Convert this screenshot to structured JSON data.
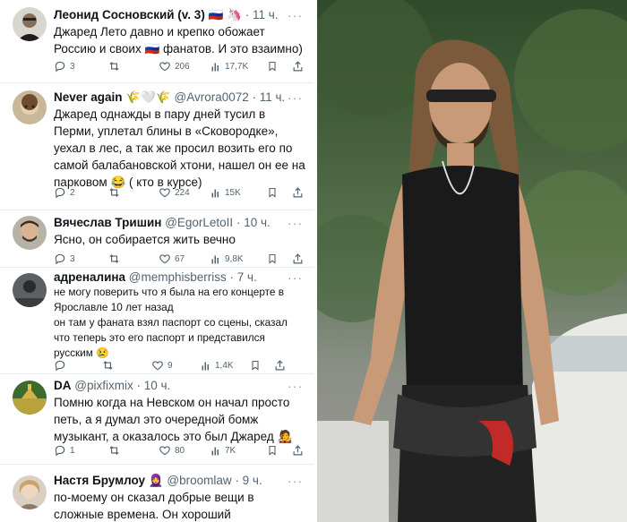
{
  "tweets": [
    {
      "author": "Леонид Сосновский (v. 3) 🇷🇺 🦄",
      "handle": "",
      "time": "· 11 ч.",
      "text": "Джаред Лето давно и крепко обожает Россию и своих 🇷🇺 фанатов. И это взаимно)",
      "replies": "3",
      "retweets": "",
      "likes": "206",
      "views": "17,7K"
    },
    {
      "author": "Never again 🌾🤍🌾",
      "handle": "@Avrora0072",
      "time": "· 11 ч.",
      "text": "Джаред однажды в пару дней тусил в Перми, уплетал блины в «Сковородке», уехал в лес, а так же просил возить его по самой балабановской хтони, нашел он ее на парковом 😂 ( кто в курсе)",
      "replies": "2",
      "retweets": "",
      "likes": "224",
      "views": "15K"
    },
    {
      "author": "Вячеслав Тришин",
      "handle": "@EgorLetoII",
      "time": "· 10 ч.",
      "text": "Ясно, он собирается жить вечно",
      "replies": "3",
      "retweets": "",
      "likes": "67",
      "views": "9,8K"
    },
    {
      "author": "адреналина",
      "handle": "@memphisberriss",
      "time": "· 7 ч.",
      "text": "не могу поверить что я была на его концерте в Ярославле 10 лет назад\nон там у фаната взял паспорт со сцены, сказал что теперь это его паспорт и представился русским 😢",
      "replies": "",
      "retweets": "",
      "likes": "9",
      "views": "1,4K"
    },
    {
      "author": "DA",
      "handle": "@pixfixmix",
      "time": "· 10 ч.",
      "text": "Помню когда на Невском он начал просто петь, а я думал это очередной бомж музыкант, а оказалось это был Джаред 🧑‍🎤",
      "replies": "1",
      "retweets": "",
      "likes": "80",
      "views": "7K"
    },
    {
      "author": "Настя Брумлоу 🧕",
      "handle": "@broomlaw",
      "time": "· 9 ч.",
      "text": "по-моему он сказал добрые вещи в сложные времена. Он хороший",
      "replies": "",
      "retweets": "",
      "likes": "",
      "views": ""
    }
  ],
  "colors": {
    "text": "#0f1419",
    "muted": "#536471",
    "divider": "#e6ecf0"
  },
  "icons": [
    "reply-icon",
    "retweet-icon",
    "like-icon",
    "views-icon",
    "bookmark-icon",
    "share-icon",
    "more-icon"
  ]
}
